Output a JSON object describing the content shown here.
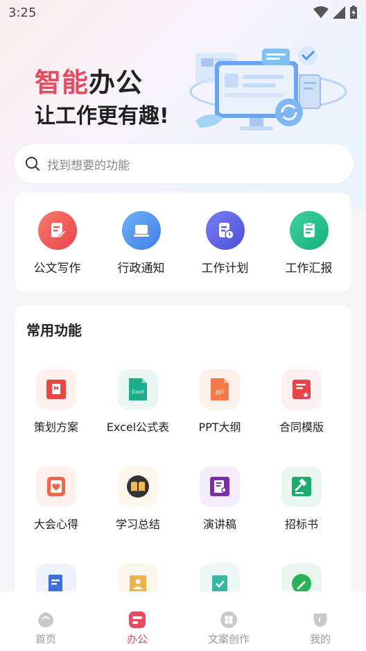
{
  "status_bar": {
    "time": "3:25"
  },
  "hero": {
    "title_accent": "智能",
    "title_rest": "办公",
    "subtitle": "让工作更有趣!"
  },
  "search": {
    "placeholder": "找到想要的功能"
  },
  "quick_actions": [
    {
      "label": "公文写作",
      "icon": "pencil-doc-icon",
      "color": "#f0575a"
    },
    {
      "label": "行政通知",
      "icon": "laptop-icon",
      "color": "#4f8ff0"
    },
    {
      "label": "工作计划",
      "icon": "doc-clock-icon",
      "color": "#5660e8"
    },
    {
      "label": "工作汇报",
      "icon": "clipboard-icon",
      "color": "#22c08a"
    }
  ],
  "common": {
    "title": "常用功能",
    "items": [
      {
        "label": "策划方案",
        "icon": "bookmark-doc-icon",
        "color": "#e8463f",
        "bg": "#fdf0ef"
      },
      {
        "label": "Excel公式表",
        "icon": "excel-icon",
        "color": "#1fae8b",
        "bg": "#eaf7f3",
        "text": "Excel"
      },
      {
        "label": "PPT大纲",
        "icon": "ppt-icon",
        "color": "#f47a4a",
        "bg": "#fdf1ec",
        "text": "ppt"
      },
      {
        "label": "合同模版",
        "icon": "contract-icon",
        "color": "#e8434b",
        "bg": "#fdf0f0"
      },
      {
        "label": "大会心得",
        "icon": "heart-notebook-icon",
        "color": "#f0674b",
        "bg": "#fdf1ee"
      },
      {
        "label": "学习总结",
        "icon": "open-book-icon",
        "color": "#333333",
        "bg": "#fdf7ec"
      },
      {
        "label": "演讲稿",
        "icon": "speech-doc-icon",
        "color": "#7a2fa8",
        "bg": "#f4ecf8"
      },
      {
        "label": "招标书",
        "icon": "gavel-icon",
        "color": "#1daa6e",
        "bg": "#e9f7ef"
      },
      {
        "label": "",
        "icon": "blue-doc-icon",
        "color": "#3d6fe0",
        "bg": "#edf2fd"
      },
      {
        "label": "",
        "icon": "yellow-image-icon",
        "color": "#f0b34a",
        "bg": "#fdf6ea"
      },
      {
        "label": "",
        "icon": "teal-check-doc-icon",
        "color": "#36b9a0",
        "bg": "#ebf8f5"
      },
      {
        "label": "",
        "icon": "green-edit-icon",
        "color": "#27b355",
        "bg": "#eaf7ee"
      }
    ]
  },
  "bottom_nav": [
    {
      "label": "首页",
      "icon": "home-icon",
      "active": false
    },
    {
      "label": "办公",
      "icon": "office-icon",
      "active": true
    },
    {
      "label": "文案创作",
      "icon": "create-icon",
      "active": false
    },
    {
      "label": "我的",
      "icon": "profile-icon",
      "active": false
    }
  ],
  "colors": {
    "accent": "#e84a5f",
    "background": "#f5f5f7"
  }
}
